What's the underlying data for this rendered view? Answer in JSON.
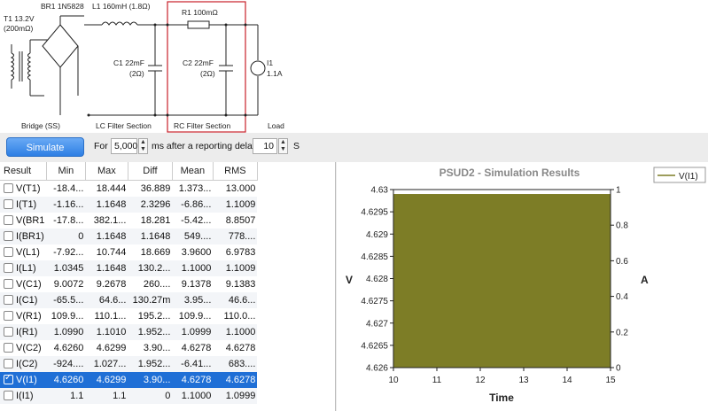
{
  "schematic": {
    "transformer": {
      "name": "T1 13.2V",
      "resistance": "(200mΩ)"
    },
    "rectifier": "BR1 1N5828",
    "inductor": "L1 160mH (1.8Ω)",
    "resistor": "R1 100mΩ",
    "c1": {
      "name": "C1 22mF",
      "esr": "(2Ω)"
    },
    "c2": {
      "name": "C2 22mF",
      "esr": "(2Ω)"
    },
    "load": {
      "name": "I1",
      "value": "1.1A"
    },
    "sections": [
      "Bridge (SS)",
      "LC Filter Section",
      "RC Filter Section",
      "Load"
    ],
    "highlight_color": "#c8202a"
  },
  "controls": {
    "simulate_label": "Simulate",
    "for_label": "For",
    "ms_value": "5,000",
    "ms_label": "ms after a reporting delay",
    "delay_value": "10",
    "s_label": "S"
  },
  "table": {
    "columns": [
      "Result",
      "Min",
      "Max",
      "Diff",
      "Mean",
      "RMS"
    ],
    "rows": [
      {
        "name": "V(T1)",
        "min": "-18.4...",
        "max": "18.444",
        "diff": "36.889",
        "mean": "1.373...",
        "rms": "13.000",
        "checked": false
      },
      {
        "name": "I(T1)",
        "min": "-1.16...",
        "max": "1.1648",
        "diff": "2.3296",
        "mean": "-6.86...",
        "rms": "1.1009",
        "checked": false
      },
      {
        "name": "V(BR1",
        "min": "-17.8...",
        "max": "382.1...",
        "diff": "18.281",
        "mean": "-5.42...",
        "rms": "8.8507",
        "checked": false
      },
      {
        "name": "I(BR1)",
        "min": "0",
        "max": "1.1648",
        "diff": "1.1648",
        "mean": "549....",
        "rms": "778....",
        "checked": false
      },
      {
        "name": "V(L1)",
        "min": "-7.92...",
        "max": "10.744",
        "diff": "18.669",
        "mean": "3.9600",
        "rms": "6.9783",
        "checked": false
      },
      {
        "name": "I(L1)",
        "min": "1.0345",
        "max": "1.1648",
        "diff": "130.2...",
        "mean": "1.1000",
        "rms": "1.1009",
        "checked": false
      },
      {
        "name": "V(C1)",
        "min": "9.0072",
        "max": "9.2678",
        "diff": "260....",
        "mean": "9.1378",
        "rms": "9.1383",
        "checked": false
      },
      {
        "name": "I(C1)",
        "min": "-65.5...",
        "max": "64.6...",
        "diff": "130.27m",
        "mean": "3.95...",
        "rms": "46.6...",
        "checked": false
      },
      {
        "name": "V(R1)",
        "min": "109.9...",
        "max": "110.1...",
        "diff": "195.2...",
        "mean": "109.9...",
        "rms": "110.0...",
        "checked": false
      },
      {
        "name": "I(R1)",
        "min": "1.0990",
        "max": "1.1010",
        "diff": "1.952...",
        "mean": "1.0999",
        "rms": "1.1000",
        "checked": false
      },
      {
        "name": "V(C2)",
        "min": "4.6260",
        "max": "4.6299",
        "diff": "3.90...",
        "mean": "4.6278",
        "rms": "4.6278",
        "checked": false
      },
      {
        "name": "I(C2)",
        "min": "-924....",
        "max": "1.027...",
        "diff": "1.952...",
        "mean": "-6.41...",
        "rms": "683....",
        "checked": false
      },
      {
        "name": "V(I1)",
        "min": "4.6260",
        "max": "4.6299",
        "diff": "3.90...",
        "mean": "4.6278",
        "rms": "4.6278",
        "checked": true
      },
      {
        "name": "I(I1)",
        "min": "1.1",
        "max": "1.1",
        "diff": "0",
        "mean": "1.1000",
        "rms": "1.0999",
        "checked": false
      }
    ],
    "selected_index": 12,
    "selection_color": "#1f6fd6"
  },
  "chart_data": {
    "type": "area",
    "title": "PSUD2 - Simulation Results",
    "xlabel": "Time",
    "ylabel": "V",
    "y2label": "A",
    "xlim": [
      10,
      15
    ],
    "ylim": [
      4.626,
      4.63
    ],
    "y2lim": [
      0,
      1
    ],
    "x_ticks": [
      "10",
      "11",
      "12",
      "13",
      "14",
      "15"
    ],
    "y_ticks": [
      "4.626",
      "4.6265",
      "4.627",
      "4.6275",
      "4.628",
      "4.6285",
      "4.629",
      "4.6295",
      "4.63"
    ],
    "y2_ticks": [
      "0",
      "0.2",
      "0.4",
      "0.6",
      "0.8",
      "1"
    ],
    "legend": "V(I1)",
    "legend_position": "top-right",
    "series": [
      {
        "name": "V(I1)",
        "x": [
          10,
          15
        ],
        "y_min": 4.626,
        "y_max": 4.6299,
        "color": "#7d7d26"
      }
    ]
  }
}
